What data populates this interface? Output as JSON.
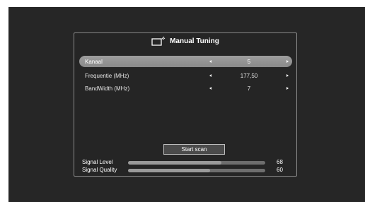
{
  "dialog": {
    "title": "Manual Tuning",
    "title_icon": "tv-antenna-icon"
  },
  "settings": [
    {
      "label": "Kanaal",
      "value": "5",
      "selected": true
    },
    {
      "label": "Frequentie (MHz)",
      "value": "177,50",
      "selected": false
    },
    {
      "label": "BandWidth (MHz)",
      "value": "7",
      "selected": false
    }
  ],
  "scan_button": {
    "label": "Start scan"
  },
  "signal": {
    "level": {
      "label": "Signal Level",
      "value": "68",
      "fraction": 0.68
    },
    "quality": {
      "label": "Signal Quality",
      "value": "60",
      "fraction": 0.6
    }
  },
  "colors": {
    "background": "#262626",
    "panel_border": "#8a8a8a",
    "selected_row": "#959595"
  }
}
